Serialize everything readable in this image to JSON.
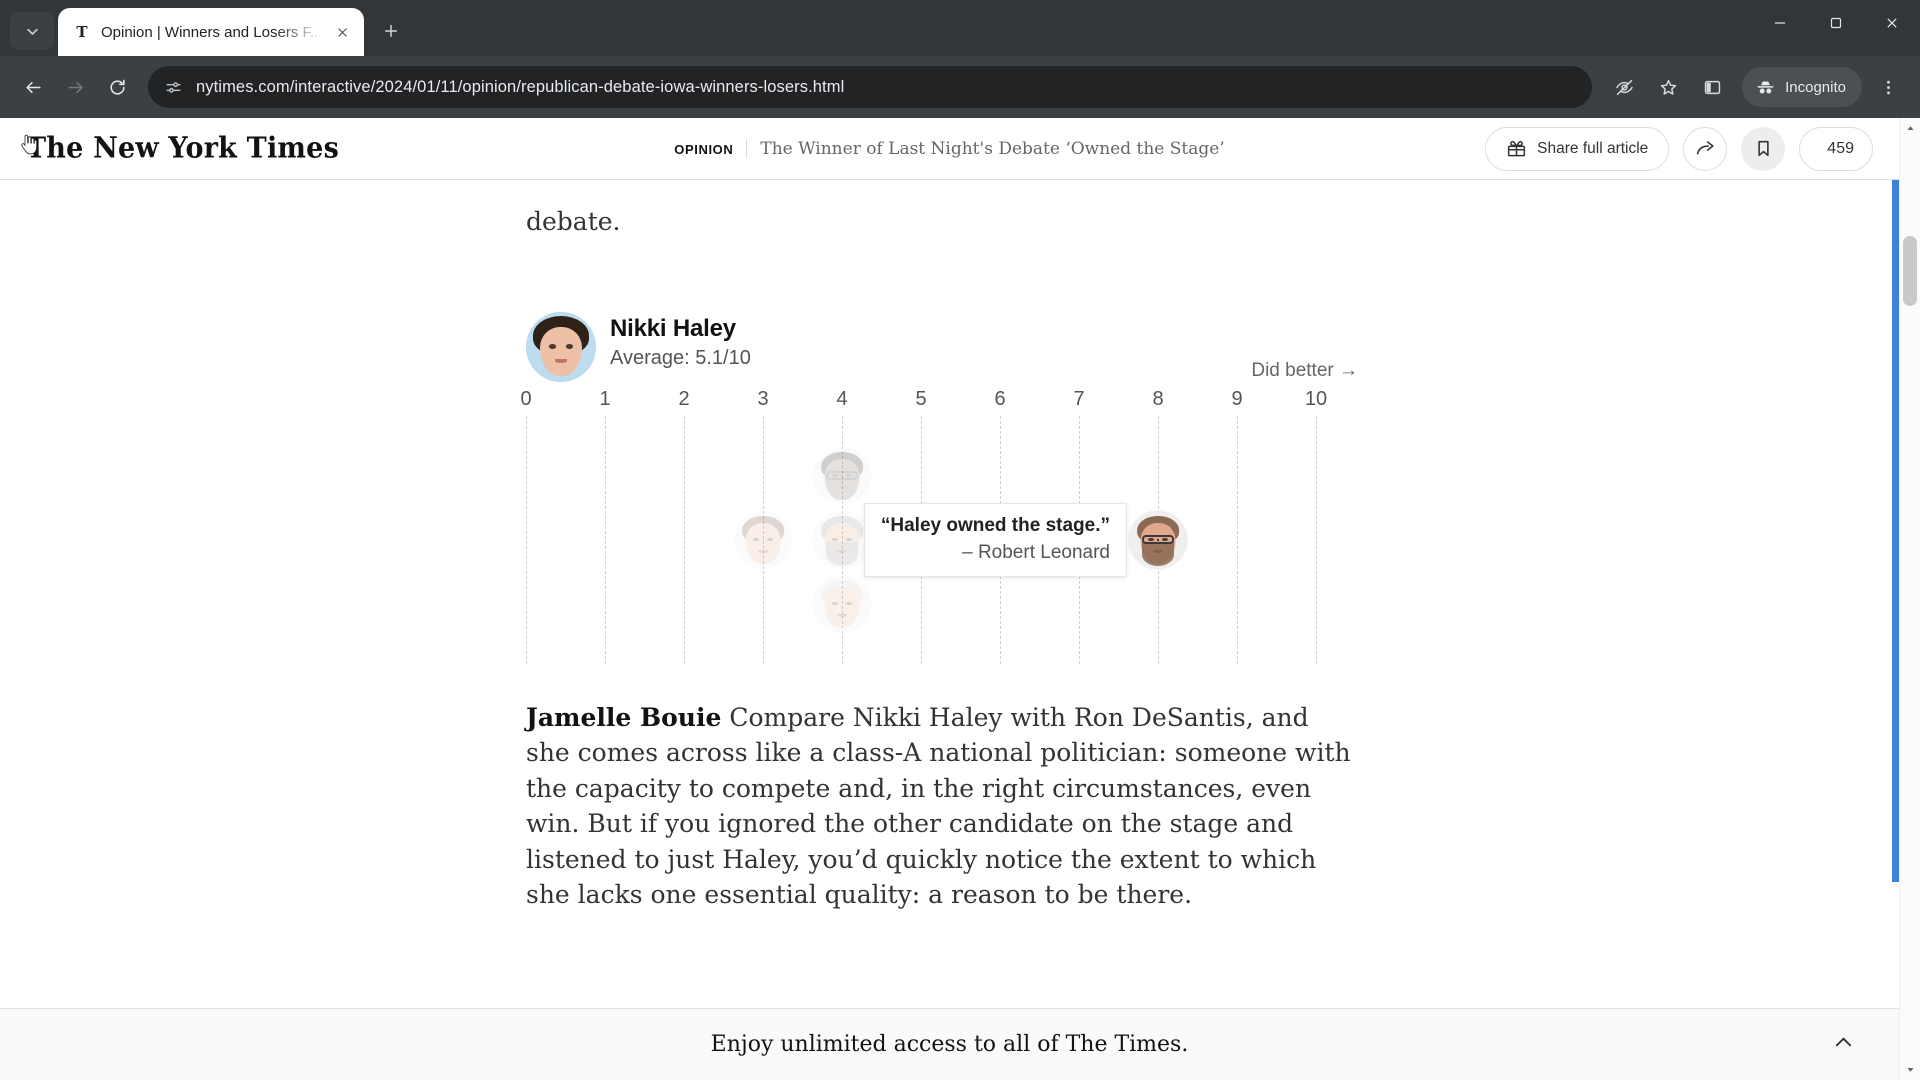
{
  "browser": {
    "tab": {
      "title": "Opinion | Winners and Losers F...",
      "favicon_letter": "T",
      "close_label": "Close tab",
      "new_tab_label": "New Tab"
    },
    "tab_search_label": "Search tabs",
    "window_controls": {
      "minimize": "Minimize",
      "maximize": "Maximize",
      "close": "Close"
    },
    "toolbar": {
      "back": "Back",
      "forward": "Forward",
      "reload": "Reload",
      "url": "nytimes.com/interactive/2024/01/11/opinion/republican-debate-iowa-winners-losers.html",
      "site_info_icon": "tune-icon",
      "tracking_protection": "third-party-cookies-blocked-icon",
      "bookmark": "Bookmark this tab",
      "side_panel": "Side panel",
      "incognito_label": "Incognito",
      "menu": "Customize and control Google Chrome"
    }
  },
  "page": {
    "masthead": "The New York Times",
    "kicker": "OPINION",
    "headline": "The Winner of Last Night's Debate ‘Owned the Stage’",
    "actions": {
      "share_full_article": "Share full article",
      "share_icon": "share-arrow-icon",
      "gift_icon": "gift-icon",
      "save_icon": "bookmark-icon",
      "comments_icon": "speech-bubble-icon",
      "comment_count": "459"
    },
    "paragraphs": [
      {
        "id": "top-fragment",
        "lead": "",
        "text": "debate."
      },
      {
        "id": "jamelle-bouie",
        "lead": "Jamelle Bouie",
        "text": " Compare Nikki Haley with Ron DeSantis, and she comes across like a class-A national politician: someone with the capacity to compete and, in the right circumstances, even win. But if you ignored the other candidate on the stage and listened to just Haley, you’d quickly notice the extent to which she lacks one essential quality: a reason to be there."
      }
    ],
    "subscribe_bar": {
      "text": "Enjoy unlimited access to all of The Times.",
      "collapse_icon": "chevron-up-icon"
    }
  },
  "chart_data": {
    "type": "scatter",
    "title": "Nikki Haley",
    "subtitle": "Average: 5.1/10",
    "average": 5.1,
    "scale_max": 10,
    "direction_label": "Did better →",
    "xlabel": "",
    "ylabel": "",
    "xlim": [
      0,
      10
    ],
    "grid": true,
    "tick_labels": [
      "0",
      "1",
      "2",
      "3",
      "4",
      "5",
      "6",
      "7",
      "8",
      "9",
      "10"
    ],
    "points": [
      {
        "score": 4,
        "stack": 1,
        "state": "faded",
        "label": "",
        "skin": "#8e7a6c",
        "hair": "#2b2b2b",
        "glasses": true,
        "beard": false
      },
      {
        "score": 3,
        "stack": 0,
        "state": "faded",
        "label": "",
        "skin": "#e7b49c",
        "hair": "#6d4a36",
        "glasses": false,
        "beard": false
      },
      {
        "score": 4,
        "stack": 0,
        "state": "faded",
        "label": "",
        "skin": "#e0b391",
        "hair": "#9a9a9a",
        "glasses": false,
        "beard": true
      },
      {
        "score": 4,
        "stack": -1,
        "state": "faded",
        "label": "",
        "skin": "#e8c0a4",
        "hair": "#d8d2cc",
        "glasses": false,
        "beard": false
      },
      {
        "score": 8,
        "stack": 0,
        "state": "active",
        "label": "Robert Leonard",
        "skin": "#e3a88c",
        "hair": "#8a6a52",
        "glasses": true,
        "beard": true
      }
    ],
    "tooltip": {
      "quote": "“Haley owned the stage.”",
      "author": "– Robert Leonard",
      "anchor_score": 8
    }
  }
}
